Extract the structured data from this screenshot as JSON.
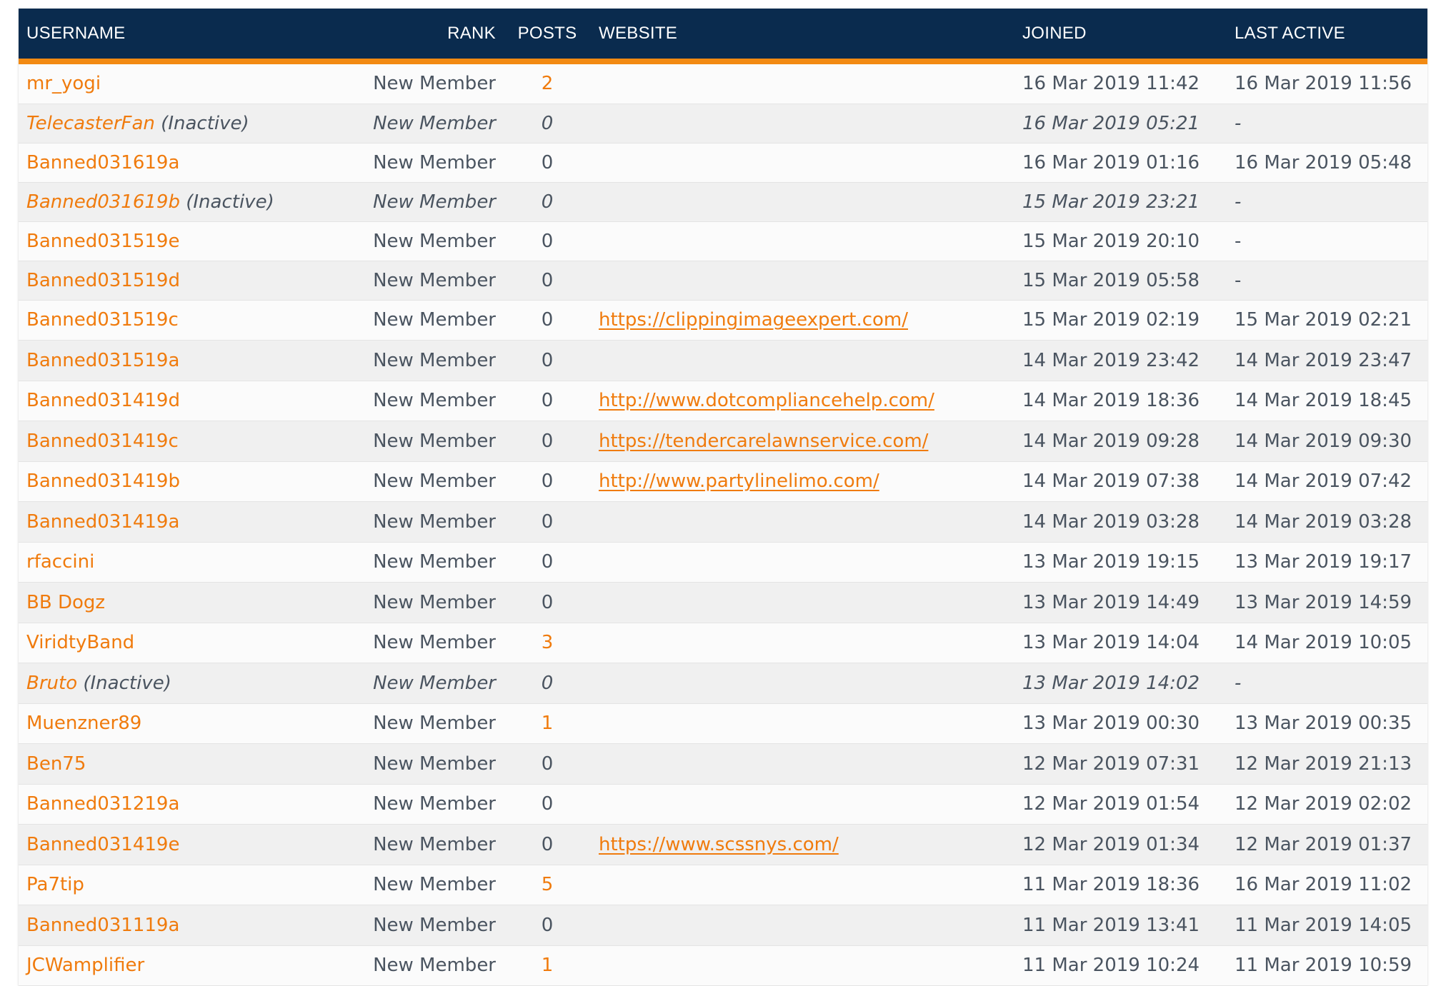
{
  "table": {
    "headers": {
      "username": "USERNAME",
      "rank": "RANK",
      "posts": "POSTS",
      "website": "WEBSITE",
      "joined": "JOINED",
      "last_active": "LAST ACTIVE"
    },
    "accent_color": "#f28a12",
    "header_color": "#0a2b4e",
    "link_color": "#f07b0d",
    "rows": [
      {
        "username": "mr_yogi",
        "inactive": false,
        "rank": "New Member",
        "posts": "2",
        "website": "",
        "joined": "16 Mar 2019 11:42",
        "last_active": "16 Mar 2019 11:56"
      },
      {
        "username": "TelecasterFan",
        "inactive": true,
        "inactive_label": "(Inactive)",
        "rank": "New Member",
        "posts": "0",
        "website": "",
        "joined": "16 Mar 2019 05:21",
        "last_active": "-"
      },
      {
        "username": "Banned031619a",
        "inactive": false,
        "rank": "New Member",
        "posts": "0",
        "website": "",
        "joined": "16 Mar 2019 01:16",
        "last_active": "16 Mar 2019 05:48"
      },
      {
        "username": "Banned031619b",
        "inactive": true,
        "inactive_label": "(Inactive)",
        "rank": "New Member",
        "posts": "0",
        "website": "",
        "joined": "15 Mar 2019 23:21",
        "last_active": "-"
      },
      {
        "username": "Banned031519e",
        "inactive": false,
        "rank": "New Member",
        "posts": "0",
        "website": "",
        "joined": "15 Mar 2019 20:10",
        "last_active": "-"
      },
      {
        "username": "Banned031519d",
        "inactive": false,
        "rank": "New Member",
        "posts": "0",
        "website": "",
        "joined": "15 Mar 2019 05:58",
        "last_active": "-"
      },
      {
        "username": "Banned031519c",
        "inactive": false,
        "rank": "New Member",
        "posts": "0",
        "website": "https://clippingimageexpert.com/",
        "joined": "15 Mar 2019 02:19",
        "last_active": "15 Mar 2019 02:21"
      },
      {
        "username": "Banned031519a",
        "inactive": false,
        "rank": "New Member",
        "posts": "0",
        "website": "",
        "joined": "14 Mar 2019 23:42",
        "last_active": "14 Mar 2019 23:47"
      },
      {
        "username": "Banned031419d",
        "inactive": false,
        "rank": "New Member",
        "posts": "0",
        "website": "http://www.dotcompliancehelp.com/",
        "joined": "14 Mar 2019 18:36",
        "last_active": "14 Mar 2019 18:45"
      },
      {
        "username": "Banned031419c",
        "inactive": false,
        "rank": "New Member",
        "posts": "0",
        "website": "https://tendercarelawnservice.com/",
        "joined": "14 Mar 2019 09:28",
        "last_active": "14 Mar 2019 09:30"
      },
      {
        "username": "Banned031419b",
        "inactive": false,
        "rank": "New Member",
        "posts": "0",
        "website": "http://www.partylinelimo.com/",
        "joined": "14 Mar 2019 07:38",
        "last_active": "14 Mar 2019 07:42"
      },
      {
        "username": "Banned031419a",
        "inactive": false,
        "rank": "New Member",
        "posts": "0",
        "website": "",
        "joined": "14 Mar 2019 03:28",
        "last_active": "14 Mar 2019 03:28"
      },
      {
        "username": "rfaccini",
        "inactive": false,
        "rank": "New Member",
        "posts": "0",
        "website": "",
        "joined": "13 Mar 2019 19:15",
        "last_active": "13 Mar 2019 19:17"
      },
      {
        "username": "BB Dogz",
        "inactive": false,
        "rank": "New Member",
        "posts": "0",
        "website": "",
        "joined": "13 Mar 2019 14:49",
        "last_active": "13 Mar 2019 14:59"
      },
      {
        "username": "ViridtyBand",
        "inactive": false,
        "rank": "New Member",
        "posts": "3",
        "website": "",
        "joined": "13 Mar 2019 14:04",
        "last_active": "14 Mar 2019 10:05"
      },
      {
        "username": "Bruto",
        "inactive": true,
        "inactive_label": "(Inactive)",
        "rank": "New Member",
        "posts": "0",
        "website": "",
        "joined": "13 Mar 2019 14:02",
        "last_active": "-"
      },
      {
        "username": "Muenzner89",
        "inactive": false,
        "rank": "New Member",
        "posts": "1",
        "website": "",
        "joined": "13 Mar 2019 00:30",
        "last_active": "13 Mar 2019 00:35"
      },
      {
        "username": "Ben75",
        "inactive": false,
        "rank": "New Member",
        "posts": "0",
        "website": "",
        "joined": "12 Mar 2019 07:31",
        "last_active": "12 Mar 2019 21:13"
      },
      {
        "username": "Banned031219a",
        "inactive": false,
        "rank": "New Member",
        "posts": "0",
        "website": "",
        "joined": "12 Mar 2019 01:54",
        "last_active": "12 Mar 2019 02:02"
      },
      {
        "username": "Banned031419e",
        "inactive": false,
        "rank": "New Member",
        "posts": "0",
        "website": "https://www.scssnys.com/",
        "joined": "12 Mar 2019 01:34",
        "last_active": "12 Mar 2019 01:37"
      },
      {
        "username": "Pa7tip",
        "inactive": false,
        "rank": "New Member",
        "posts": "5",
        "website": "",
        "joined": "11 Mar 2019 18:36",
        "last_active": "16 Mar 2019 11:02"
      },
      {
        "username": "Banned031119a",
        "inactive": false,
        "rank": "New Member",
        "posts": "0",
        "website": "",
        "joined": "11 Mar 2019 13:41",
        "last_active": "11 Mar 2019 14:05"
      },
      {
        "username": "JCWamplifier",
        "inactive": false,
        "rank": "New Member",
        "posts": "1",
        "website": "",
        "joined": "11 Mar 2019 10:24",
        "last_active": "11 Mar 2019 10:59"
      }
    ]
  }
}
